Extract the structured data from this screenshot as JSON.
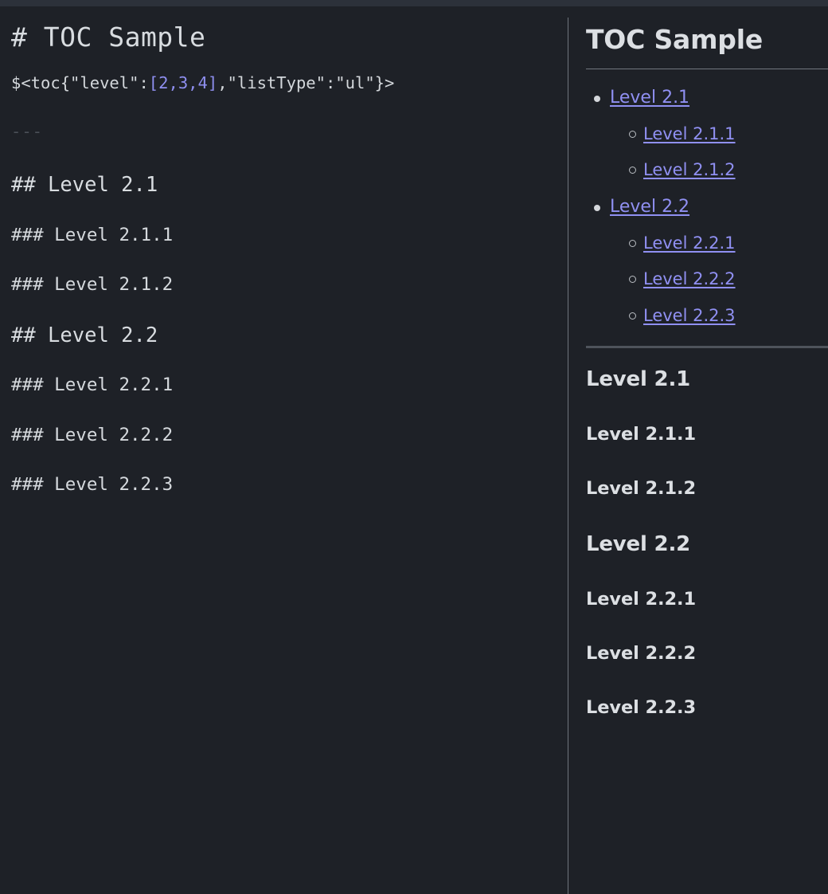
{
  "theme": {
    "background": "#1e2127",
    "top_strip": "#2c313a",
    "editor_text": "#d3d7db",
    "link_color": "#9090f2",
    "divider": "#6f757d",
    "rule": "#71777f",
    "muted": "#4b5058",
    "heading_color": "#dcdfe3"
  },
  "editor": {
    "name": "markdown-source-editor",
    "lines": {
      "h1": "# TOC Sample",
      "toc_directive_prefix": "$<toc{\"level\":",
      "toc_directive_levels": "[2,3,4]",
      "toc_directive_suffix": ",\"listType\":\"ul\"}>",
      "hr": "---",
      "h2_a": "## Level 2.1",
      "h3_a1": "### Level 2.1.1",
      "h3_a2": "### Level 2.1.2",
      "h2_b": "## Level 2.2",
      "h3_b1": "### Level 2.2.1",
      "h3_b2": "### Level 2.2.2",
      "h3_b3": "### Level 2.2.3"
    }
  },
  "preview": {
    "name": "markdown-rendered-preview",
    "title": "TOC Sample",
    "toc": [
      {
        "label": "Level 2.1",
        "children": [
          {
            "label": "Level 2.1.1"
          },
          {
            "label": "Level 2.1.2"
          }
        ]
      },
      {
        "label": "Level 2.2",
        "children": [
          {
            "label": "Level 2.2.1"
          },
          {
            "label": "Level 2.2.2"
          },
          {
            "label": "Level 2.2.3"
          }
        ]
      }
    ],
    "headings": [
      {
        "level": 2,
        "label": "Level 2.1"
      },
      {
        "level": 3,
        "label": "Level 2.1.1"
      },
      {
        "level": 3,
        "label": "Level 2.1.2"
      },
      {
        "level": 2,
        "label": "Level 2.2"
      },
      {
        "level": 3,
        "label": "Level 2.2.1"
      },
      {
        "level": 3,
        "label": "Level 2.2.2"
      },
      {
        "level": 3,
        "label": "Level 2.2.3"
      }
    ]
  }
}
